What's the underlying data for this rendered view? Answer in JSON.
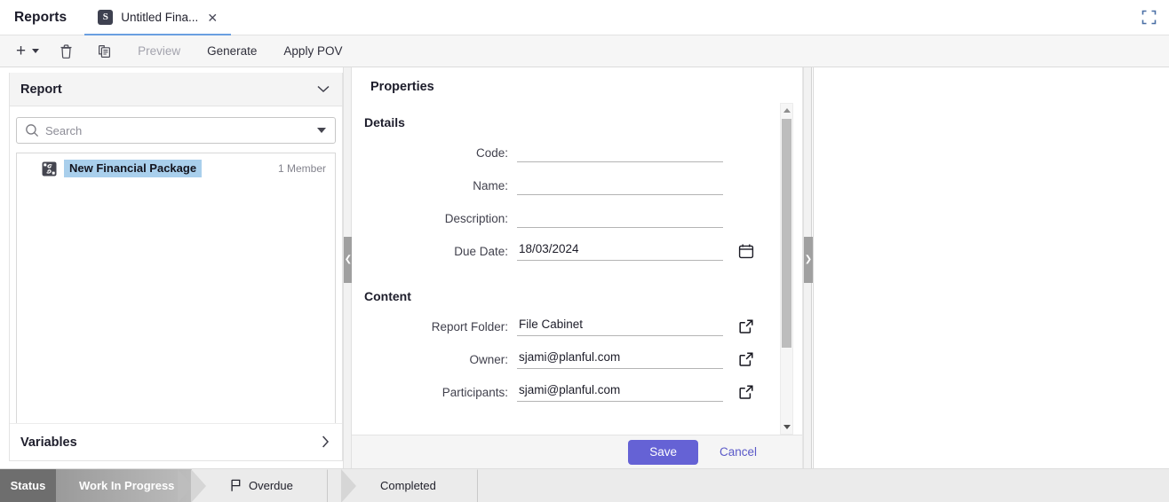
{
  "topbar": {
    "app_title": "Reports",
    "tab": {
      "icon": "report-doc-icon",
      "icon_glyph": "S",
      "label": "Untitled Fina...",
      "close_glyph": "✕"
    },
    "fullscreen_icon": "fullscreen-expand-icon"
  },
  "toolbar": {
    "add_icon": "plus-icon",
    "add_glyph": "+",
    "add_dropdown_icon": "chevron-down-icon",
    "delete_icon": "trash-icon",
    "copy_icon": "copy-document-icon",
    "preview_label": "Preview",
    "generate_label": "Generate",
    "apply_pov_label": "Apply POV"
  },
  "left_panel": {
    "header_title": "Report",
    "header_chevron_icon": "chevron-down-icon",
    "search": {
      "icon": "search-icon",
      "placeholder": "Search",
      "value": "",
      "dropdown_icon": "caret-down-icon"
    },
    "tree": [
      {
        "icon": "package-icon",
        "label": "New Financial Package",
        "meta": "1 Member",
        "selected": true
      }
    ],
    "variables": {
      "label": "Variables",
      "chevron_icon": "chevron-right-icon"
    }
  },
  "splitters": {
    "left_handle_icon": "chevron-left-icon",
    "left_handle_glyph": "❮",
    "right_handle_icon": "chevron-right-icon",
    "right_handle_glyph": "❯"
  },
  "properties": {
    "title": "Properties",
    "sections": [
      {
        "heading": "Details",
        "fields": [
          {
            "label": "Code:",
            "value": "",
            "placeholder": "",
            "action_icon": null
          },
          {
            "label": "Name:",
            "value": "",
            "placeholder": "",
            "action_icon": null
          },
          {
            "label": "Description:",
            "value": "",
            "placeholder": "",
            "action_icon": null
          },
          {
            "label": "Due Date:",
            "value": "18/03/2024",
            "placeholder": "",
            "action_icon": "calendar-icon"
          }
        ]
      },
      {
        "heading": "Content",
        "fields": [
          {
            "label": "Report Folder:",
            "value": "File Cabinet",
            "placeholder": "",
            "action_icon": "open-external-icon"
          },
          {
            "label": "Owner:",
            "value": "sjami@planful.com",
            "placeholder": "",
            "action_icon": "open-external-icon"
          },
          {
            "label": "Participants:",
            "value": "sjami@planful.com",
            "placeholder": "",
            "action_icon": "open-external-icon"
          }
        ]
      }
    ],
    "scrollbar": {
      "up_icon": "scroll-up-arrow-icon",
      "down_icon": "scroll-down-arrow-icon"
    },
    "footer": {
      "save_label": "Save",
      "cancel_label": "Cancel"
    }
  },
  "statusbar": {
    "label": "Status",
    "steps": [
      {
        "label": "Work In Progress",
        "state": "active",
        "icon": null
      },
      {
        "label": "Overdue",
        "state": "idle",
        "icon": "flag-icon"
      },
      {
        "label": "Completed",
        "state": "idle",
        "icon": null
      }
    ]
  },
  "colors": {
    "accent_save": "#6562d5",
    "accent_link": "#5a59c8",
    "tab_underline": "#6a9fe0",
    "selection_highlight": "#a9cfec",
    "status_label_bg": "#6e6e6e"
  }
}
